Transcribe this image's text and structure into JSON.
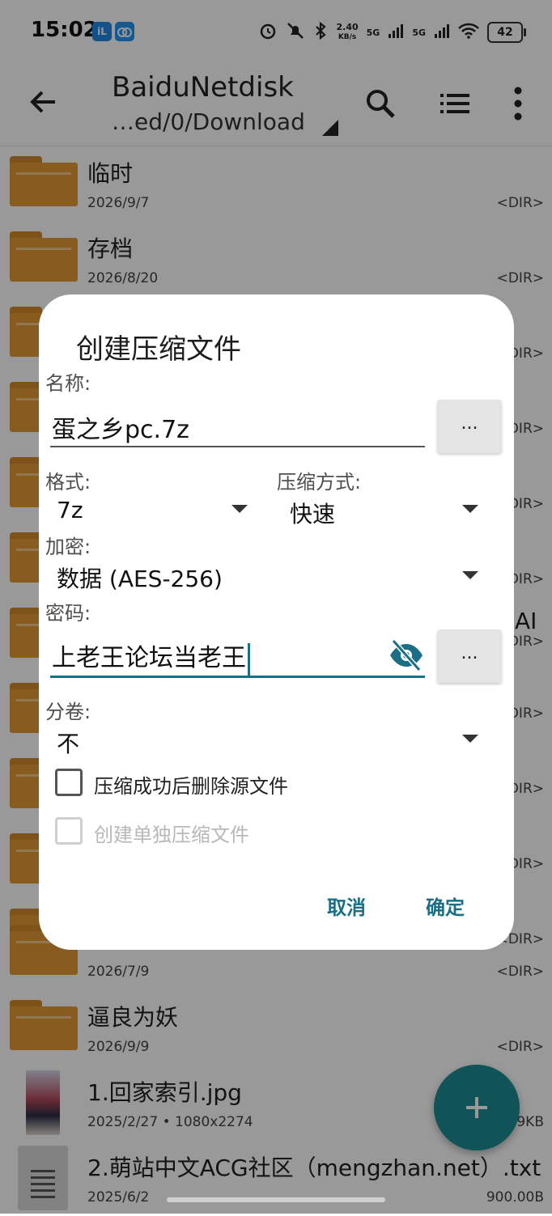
{
  "status_bar": {
    "time": "15:02",
    "badge1": "iL",
    "net_speed_value": "2.40",
    "net_speed_unit": "KB/s",
    "sim1": "5G",
    "sim2": "5G",
    "battery": "42"
  },
  "app_bar": {
    "title": "BaiduNetdisk",
    "path": "…ed/0/Download"
  },
  "files": [
    {
      "name": "临时",
      "date": "2026/9/7",
      "size": "<DIR>"
    },
    {
      "name": "存档",
      "date": "2026/8/20",
      "size": "<DIR>"
    },
    {
      "name": "",
      "date": "",
      "size": "<DIR>"
    },
    {
      "name": "",
      "date": "",
      "size": "<DIR>"
    },
    {
      "name": "",
      "date": "",
      "size": "<DIR>"
    },
    {
      "name": "",
      "date": "",
      "size": "<DIR>"
    },
    {
      "name": "AI",
      "date": "",
      "size": "<DIR>"
    },
    {
      "name": "",
      "date": "",
      "size": "<DIR>"
    },
    {
      "name": "",
      "date": "",
      "size": "<DIR>"
    },
    {
      "name": "",
      "date": "",
      "size": "<DIR>"
    },
    {
      "name": "",
      "date": "",
      "size": "<DIR>"
    },
    {
      "name": "",
      "date": "2026/7/9",
      "size": "<DIR>"
    },
    {
      "name": "逼良为妖",
      "date": "2026/9/9",
      "size": "<DIR>"
    },
    {
      "name": "1.回家索引.jpg",
      "date": "2025/2/27 • 1080x2274",
      "size": "9KB"
    },
    {
      "name": "2.萌站中文ACG社区（mengzhan.net）.txt",
      "date": "2025/6/2",
      "size": "900.00B"
    }
  ],
  "dialog": {
    "title": "创建压缩文件",
    "name_label": "名称:",
    "name_value": "蛋之乡pc.7z",
    "browse_label": "...",
    "format_label": "格式:",
    "format_value": "7z",
    "method_label": "压缩方式:",
    "method_value": "快速",
    "encryption_label": "加密:",
    "encryption_value": "数据 (AES-256)",
    "password_label": "密码:",
    "password_value": "上老王论坛当老王",
    "password_more_label": "...",
    "split_label": "分卷:",
    "split_value": "不",
    "delete_source_label": "压缩成功后删除源文件",
    "separate_archives_label": "创建单独压缩文件",
    "cancel_label": "取消",
    "ok_label": "确定"
  },
  "colors": {
    "accent": "#1a6f86",
    "fab": "#1b8a93",
    "folder": "#e39a35"
  }
}
